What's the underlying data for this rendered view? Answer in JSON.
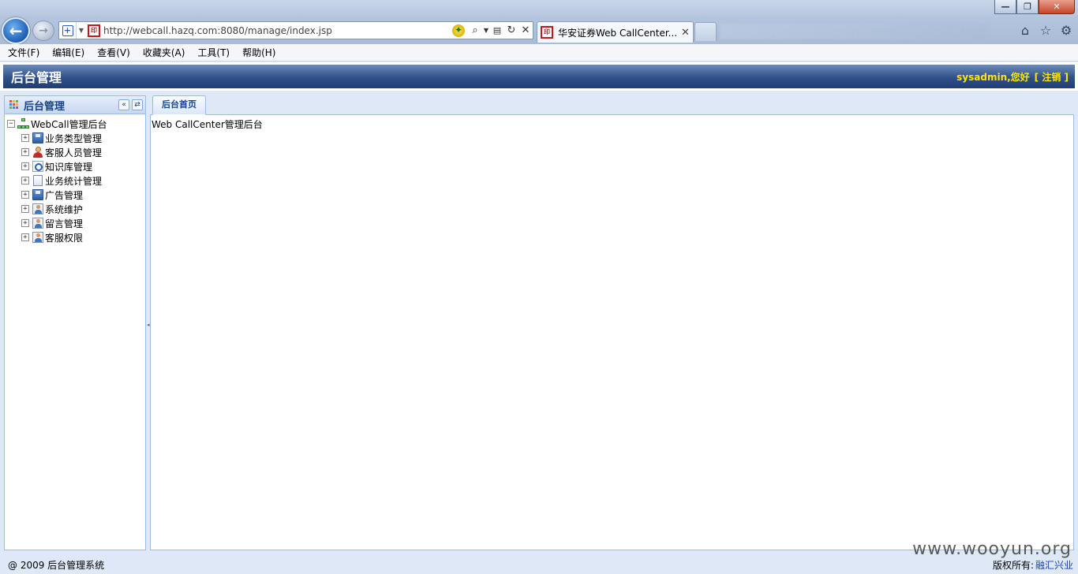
{
  "browser": {
    "url": "http://webcall.hazq.com:8080/manage/index.jsp",
    "active_tab_title": "华安证券Web CallCenter...",
    "menu": [
      "文件(F)",
      "编辑(E)",
      "查看(V)",
      "收藏夹(A)",
      "工具(T)",
      "帮助(H)"
    ]
  },
  "header": {
    "title": "后台管理",
    "user_greeting": "sysadmin,您好",
    "logout_label": "[ 注销 ]"
  },
  "left_panel": {
    "title": "后台管理",
    "tree": {
      "root": "WebCall管理后台",
      "items": [
        {
          "label": "业务类型管理",
          "icon": "floppy-icon"
        },
        {
          "label": "客服人员管理",
          "icon": "user-icon"
        },
        {
          "label": "知识库管理",
          "icon": "search-doc-icon"
        },
        {
          "label": "业务统计管理",
          "icon": "document-icon"
        },
        {
          "label": "广告管理",
          "icon": "floppy-icon"
        },
        {
          "label": "系统维护",
          "icon": "person-card-icon"
        },
        {
          "label": "留言管理",
          "icon": "person-card-icon"
        },
        {
          "label": "客服权限",
          "icon": "person-card-icon"
        }
      ]
    }
  },
  "main": {
    "tab_label": "后台首页",
    "content_text": "Web CallCenter管理后台"
  },
  "footer": {
    "copyright": "@ 2009 后台管理系统",
    "rights_label": "版权所有:",
    "rights_owner": "融汇兴业"
  },
  "watermark": "www.wooyun.org",
  "colors": {
    "header_bg": "#2f5189",
    "header_user_text": "#ffe600",
    "panel_title": "#15428b",
    "panel_border": "#99bbe8"
  }
}
